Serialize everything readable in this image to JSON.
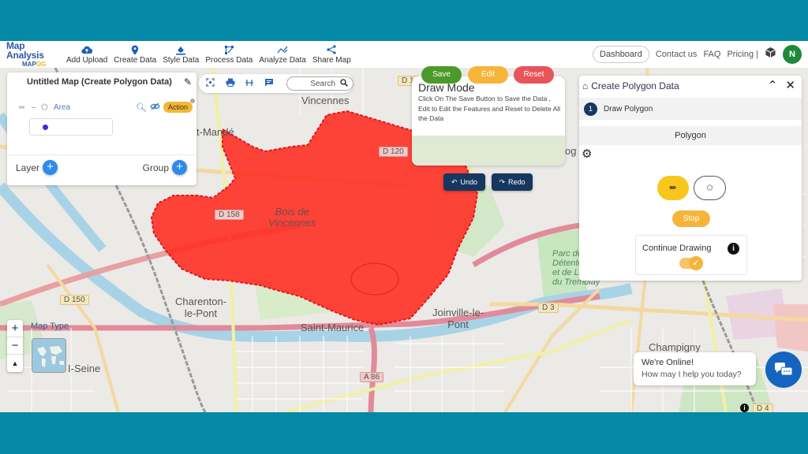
{
  "header": {
    "logo_title": "Map Analysis",
    "logo_sub_a": "MAP",
    "logo_sub_b": "OG",
    "nav": [
      {
        "label": "Add Upload",
        "icon": "cloud-upload-icon"
      },
      {
        "label": "Create Data",
        "icon": "map-pin-icon"
      },
      {
        "label": "Style Data",
        "icon": "paint-bucket-icon"
      },
      {
        "label": "Process Data",
        "icon": "process-icon"
      },
      {
        "label": "Analyze Data",
        "icon": "analyze-icon"
      },
      {
        "label": "Share Map",
        "icon": "share-icon"
      }
    ],
    "dashboard": "Dashboard",
    "contact": "Contact us",
    "faq": "FAQ",
    "pricing": "Pricing |",
    "avatar_initial": "N"
  },
  "layer_panel": {
    "title": "Untitled Map (Create Polygon Data)",
    "layer_name": "Area",
    "action_label": "Action",
    "layer_label": "Layer",
    "group_label": "Group",
    "layer_color": "#3a2fd8"
  },
  "toolbar": {
    "search_placeholder": "Search"
  },
  "draw_mode": {
    "title": "Draw Mode",
    "description": "Click On The Save Button to Save the Data , Edit to Edit the Features and Reset to Delete All the Data",
    "save": "Save",
    "edit": "Edit",
    "reset": "Reset",
    "undo": "Undo",
    "redo": "Redo"
  },
  "create_polygon": {
    "title": "Create Polygon Data",
    "step_number": "1",
    "step_label": "Draw Polygon",
    "subheader": "Polygon",
    "stop": "Stop",
    "continue_drawing": "Continue Drawing",
    "continue_drawing_enabled": true
  },
  "map": {
    "labels": {
      "vincennes": "Vincennes",
      "saint_mande": "t-Mandé",
      "bois_1": "Bois de",
      "bois_2": "Vincennes",
      "charenton_1": "Charenton-",
      "charenton_2": "le-Pont",
      "saint_maurice": "Saint-Maurice",
      "joinville_1": "Joinville-le-",
      "joinville_2": "Pont",
      "parc_1": "Parc de",
      "parc_2": "Détente",
      "parc_3": "et de Loisirs",
      "parc_4": "du Tremblay",
      "champigny": "Champigny",
      "seine": "I-Seine",
      "nogent": "og M"
    },
    "roads": {
      "d1": "D 1",
      "d120": "D 120",
      "d158": "D 158",
      "d150": "D 150",
      "d3": "D 3",
      "a86": "A 86",
      "d4": "D 4"
    },
    "polygon_fill": "#ff2a20",
    "map_type_label": "Map Type"
  },
  "chat": {
    "line1": "We're Online!",
    "line2": "How may I help you today?"
  }
}
